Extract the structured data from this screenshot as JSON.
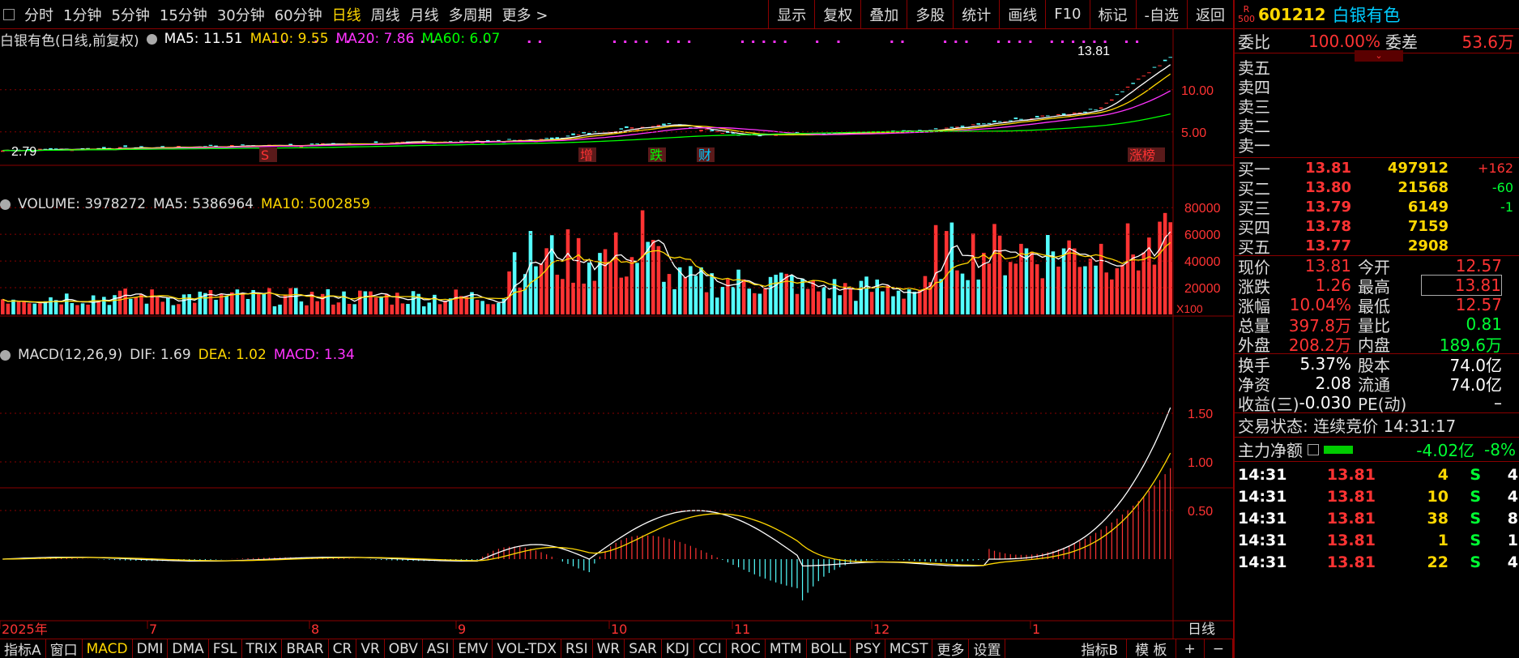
{
  "toolbar": {
    "left_items": [
      "分时",
      "1分钟",
      "5分钟",
      "15分钟",
      "30分钟",
      "60分钟",
      "日线",
      "周线",
      "月线",
      "多周期",
      "更多 >"
    ],
    "active_item": "日线",
    "right_items": [
      "显示",
      "复权",
      "叠加",
      "多股",
      "统计",
      "画线",
      "F10",
      "标记",
      "-自选",
      "返回"
    ]
  },
  "price_legend": {
    "title": "白银有色(日线,前复权)",
    "ma5": "MA5: 11.51",
    "ma10": "MA10: 9.55",
    "ma20": "MA20: 7.86",
    "ma60": "MA60: 6.07",
    "high_label": "13.81",
    "low_label": "2.79",
    "axis_labels": [
      "10.00",
      "5.00"
    ],
    "markers": [
      "S",
      "增",
      "跌",
      "财",
      "涨榜"
    ]
  },
  "volume_legend": {
    "title": "VOLUME: 3978272",
    "ma5": "MA5: 5386964",
    "ma10": "MA10: 5002859",
    "axis_labels": [
      "80000",
      "60000",
      "40000",
      "20000"
    ],
    "unit": "X100"
  },
  "macd_legend": {
    "title": "MACD(12,26,9)",
    "dif": "DIF: 1.69",
    "dea": "DEA: 1.02",
    "macd": "MACD: 1.34",
    "axis_labels": [
      "1.50",
      "1.00",
      "0.50"
    ]
  },
  "time_axis": [
    "2025年",
    "7",
    "8",
    "9",
    "10",
    "11",
    "12",
    "1"
  ],
  "time_axis_unit": "日线",
  "bottom_bar": {
    "items": [
      "指标A",
      "窗口",
      "MACD",
      "DMI",
      "DMA",
      "FSL",
      "TRIX",
      "BRAR",
      "CR",
      "VR",
      "OBV",
      "ASI",
      "EMV",
      "VOL-TDX",
      "RSI",
      "WR",
      "SAR",
      "KDJ",
      "CCI",
      "ROC",
      "MTM",
      "BOLL",
      "PSY",
      "MCST",
      "更多",
      "设置"
    ],
    "active": "MACD",
    "right_items": [
      "指标B",
      "模 板",
      "+",
      "−"
    ]
  },
  "quote": {
    "badge_top": "R",
    "badge_bottom": "500",
    "code": "601212",
    "name": "白银有色",
    "weibi_label": "委比",
    "weibi_value": "100.00%",
    "weicha_label": "委差",
    "weicha_value": "53.6万",
    "sell": [
      {
        "label": "卖五"
      },
      {
        "label": "卖四"
      },
      {
        "label": "卖三"
      },
      {
        "label": "卖二"
      },
      {
        "label": "卖一"
      }
    ],
    "buy": [
      {
        "label": "买一",
        "price": "13.81",
        "vol": "497912",
        "chg": "+162"
      },
      {
        "label": "买二",
        "price": "13.80",
        "vol": "21568",
        "chg": "-60"
      },
      {
        "label": "买三",
        "price": "13.79",
        "vol": "6149",
        "chg": "-1"
      },
      {
        "label": "买四",
        "price": "13.78",
        "vol": "7159",
        "chg": ""
      },
      {
        "label": "买五",
        "price": "13.77",
        "vol": "2908",
        "chg": ""
      }
    ],
    "stats": [
      {
        "l1": "现价",
        "v1": "13.81",
        "l2": "今开",
        "v2": "12.57"
      },
      {
        "l1": "涨跌",
        "v1": "1.26",
        "l2": "最高",
        "v2": "13.81"
      },
      {
        "l1": "涨幅",
        "v1": "10.04%",
        "l2": "最低",
        "v2": "12.57"
      },
      {
        "l1": "总量",
        "v1": "397.8万",
        "l2": "量比",
        "v2": "0.81"
      },
      {
        "l1": "外盘",
        "v1": "208.2万",
        "l2": "内盘",
        "v2": "189.6万"
      }
    ],
    "stats2": [
      {
        "l1": "换手",
        "v1": "5.37%",
        "l2": "股本",
        "v2": "74.0亿"
      },
      {
        "l1": "净资",
        "v1": "2.08",
        "l2": "流通",
        "v2": "74.0亿"
      },
      {
        "l1": "收益(三)",
        "v1": "-0.030",
        "l2": "PE(动)",
        "v2": "–"
      }
    ],
    "trade_status": "交易状态: 连续竞价 14:31:17",
    "main_force_label": "主力净额",
    "main_force_value": "-4.02亿",
    "main_force_pct": "-8%",
    "ticks": [
      {
        "time": "14:31",
        "price": "13.81",
        "vol": "4",
        "side": "S",
        "n": "4"
      },
      {
        "time": "14:31",
        "price": "13.81",
        "vol": "10",
        "side": "S",
        "n": "4"
      },
      {
        "time": "14:31",
        "price": "13.81",
        "vol": "38",
        "side": "S",
        "n": "8"
      },
      {
        "time": "14:31",
        "price": "13.81",
        "vol": "1",
        "side": "S",
        "n": "1"
      },
      {
        "time": "14:31",
        "price": "13.81",
        "vol": "22",
        "side": "S",
        "n": "4"
      }
    ]
  },
  "colors": {
    "up": "#ff3333",
    "down": "#54ffff",
    "ma5": "#ffffff",
    "ma10": "#ffd700",
    "ma20": "#ff33ff",
    "ma60": "#00ff00",
    "grid": "#8a0000"
  }
}
